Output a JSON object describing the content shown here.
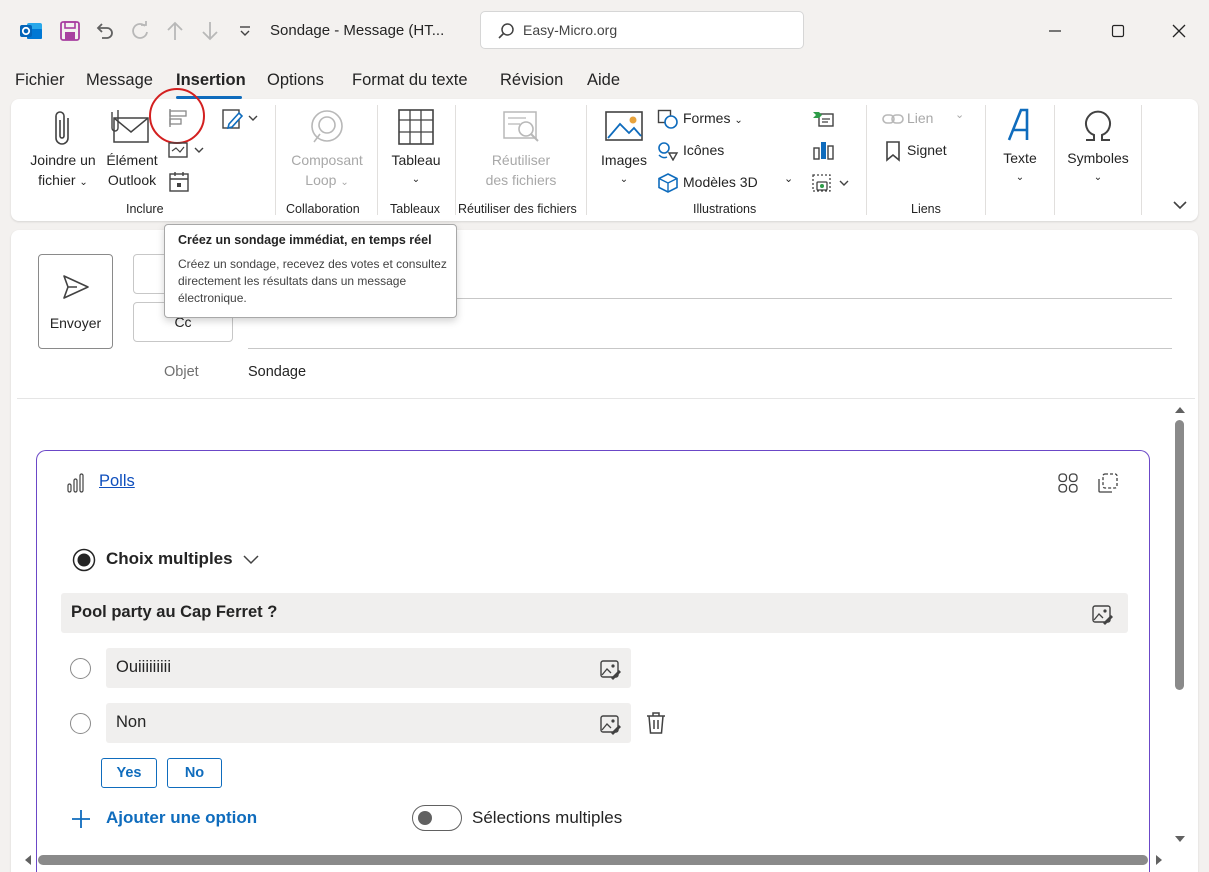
{
  "titlebar": {
    "title": "Sondage  -  Message (HT...",
    "search_value": "Easy-Micro.org",
    "quick_access_icons": [
      "outlook-app-icon",
      "save-icon",
      "undo-icon",
      "redo-icon",
      "up-arrow-icon",
      "down-arrow-icon",
      "customize-dropdown-icon"
    ],
    "window_controls": [
      "minimize-icon",
      "maximize-icon",
      "close-icon"
    ]
  },
  "menu": {
    "items": [
      "Fichier",
      "Message",
      "Insertion",
      "Options",
      "Format du texte",
      "Révision",
      "Aide"
    ],
    "active": "Insertion"
  },
  "ribbon": {
    "groups": {
      "inclure": "Inclure",
      "collaboration": "Collaboration",
      "tableaux": "Tableaux",
      "reutiliser": "Réutiliser des fichiers",
      "illustrations": "Illustrations",
      "liens": "Liens"
    },
    "attach": {
      "line1": "Joindre un",
      "line2": "fichier"
    },
    "outlook_item": {
      "line1": "Élément",
      "line2": "Outlook"
    },
    "loop": {
      "line1": "Composant",
      "line2": "Loop"
    },
    "table": {
      "line1": "Tableau"
    },
    "reuse": {
      "line1": "Réutiliser",
      "line2": "des fichiers"
    },
    "images": "Images",
    "shapes": "Formes",
    "icons": "Icônes",
    "models3d": "Modèles 3D",
    "link": "Lien",
    "bookmark": "Signet",
    "text": "Texte",
    "symbols": "Symboles"
  },
  "tooltip": {
    "title": "Créez un sondage immédiat, en temps réel",
    "body": "Créez un sondage, recevez des votes et consultez directement les résultats dans un message électronique."
  },
  "compose": {
    "send_label": "Envoyer",
    "cc_label": "Cc",
    "subject_label": "Objet",
    "subject_value": "Sondage"
  },
  "poll": {
    "header_link": "Polls",
    "type_label": "Choix multiples",
    "question": "Pool party au Cap Ferret ?",
    "options": [
      "Ouiiiiiiiii",
      "Non"
    ],
    "suggestions": [
      "Yes",
      "No"
    ],
    "add_option_label": "Ajouter une option",
    "multi_select_label": "Sélections multiples",
    "multi_select_on": false
  },
  "colors": {
    "accent": "#0f6cbd",
    "card_border": "#6b48c7",
    "highlight_circle": "#d32020"
  }
}
